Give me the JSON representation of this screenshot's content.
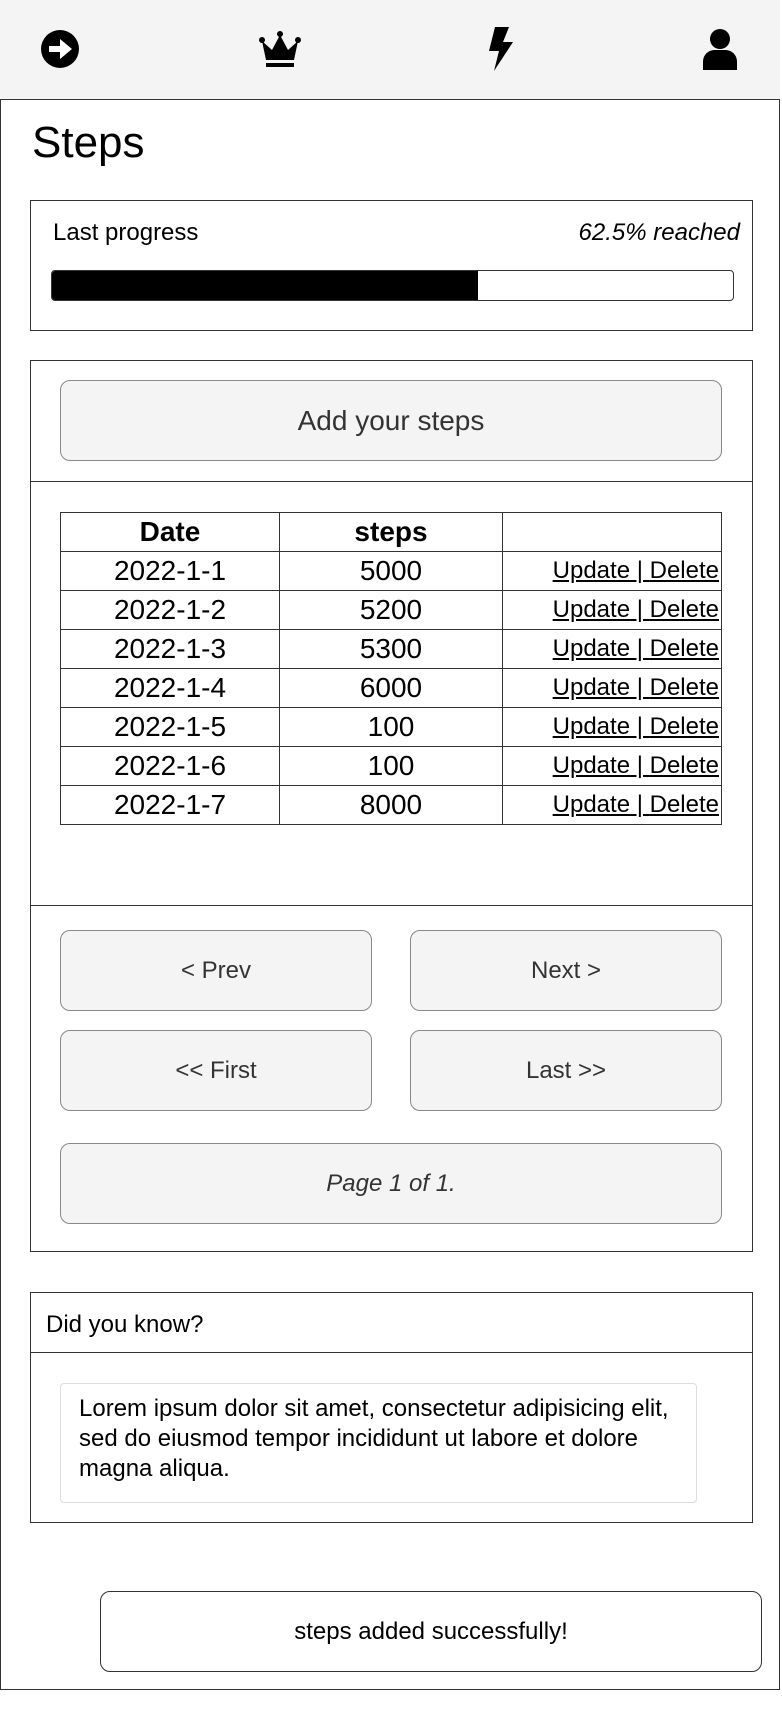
{
  "nav": {
    "icons": [
      "arrow-right-circle-icon",
      "crown-icon",
      "bolt-icon",
      "user-icon"
    ]
  },
  "page": {
    "title": "Steps"
  },
  "progress": {
    "label": "Last progress",
    "reached_text": "62.5% reached",
    "fraction": 0.625
  },
  "add_button": {
    "label": "Add your steps"
  },
  "table": {
    "headers": [
      "Date",
      "steps",
      ""
    ],
    "rows": [
      {
        "date": "2022-1-1",
        "steps": "5000"
      },
      {
        "date": "2022-1-2",
        "steps": "5200"
      },
      {
        "date": "2022-1-3",
        "steps": "5300"
      },
      {
        "date": "2022-1-4",
        "steps": "6000"
      },
      {
        "date": "2022-1-5",
        "steps": "100"
      },
      {
        "date": "2022-1-6",
        "steps": "100"
      },
      {
        "date": "2022-1-7",
        "steps": "8000"
      }
    ],
    "update_label": "Update",
    "separator": " | ",
    "delete_label": "Delete"
  },
  "pagination": {
    "prev_label": "< Prev",
    "next_label": "Next >",
    "first_label": "<< First",
    "last_label": "Last >>",
    "page_info": "Page 1 of 1."
  },
  "tip": {
    "heading": "Did you know?",
    "body": "Lorem ipsum dolor sit amet, consectetur adipisicing elit, sed do eiusmod tempor incididunt ut labore et dolore magna aliqua."
  },
  "toast": {
    "message": "steps added successfully!"
  }
}
